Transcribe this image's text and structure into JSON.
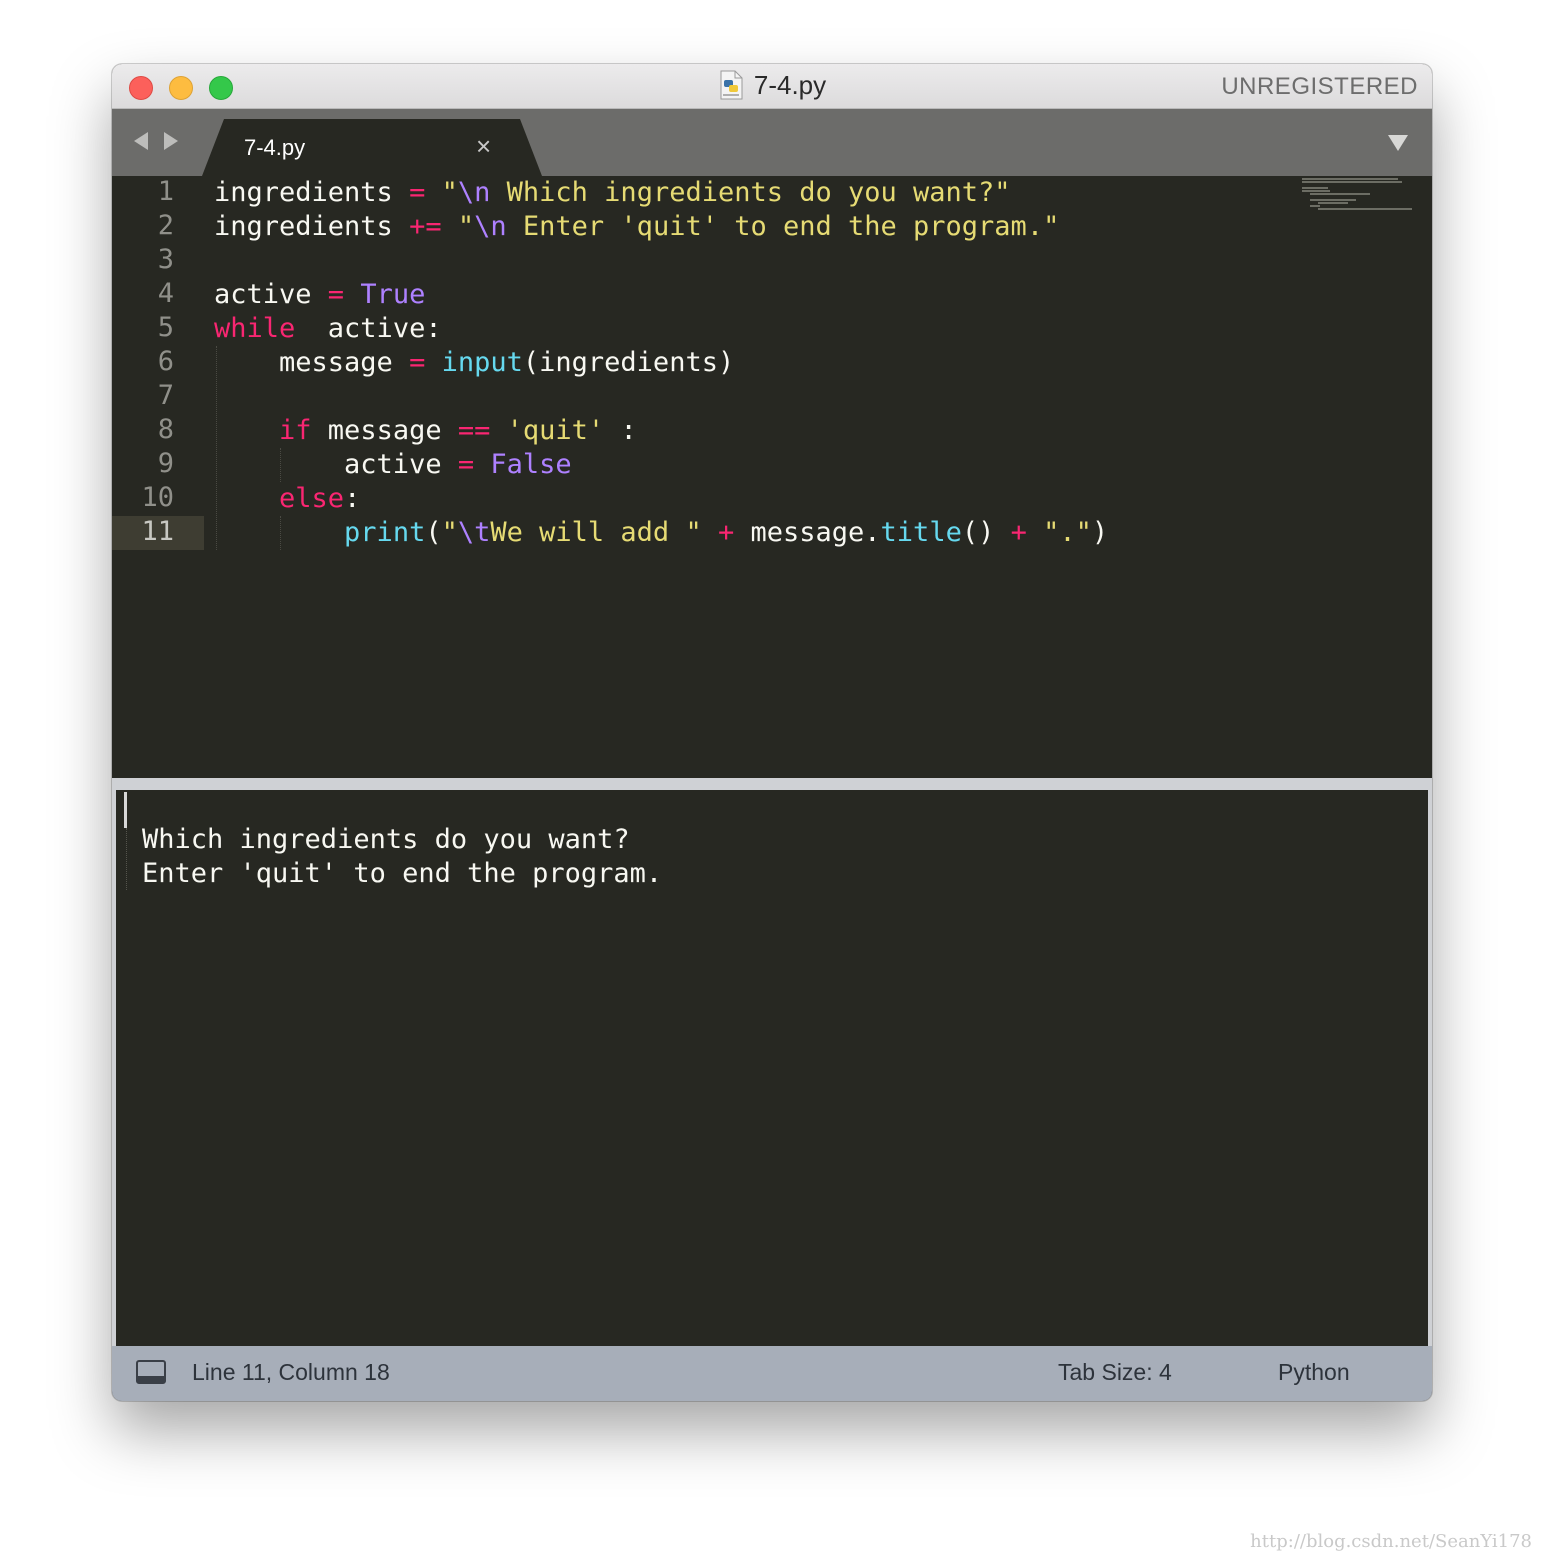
{
  "window": {
    "title": "7-4.py",
    "registration_label": "UNREGISTERED"
  },
  "tabs": [
    {
      "label": "7-4.py",
      "active": true
    }
  ],
  "editor": {
    "language": "Python",
    "current_line": 11,
    "lines": [
      {
        "number": "1",
        "text": "ingredients = \"\\n Which ingredients do you want?\""
      },
      {
        "number": "2",
        "text": "ingredients += \"\\n Enter 'quit' to end the program.\""
      },
      {
        "number": "3",
        "text": ""
      },
      {
        "number": "4",
        "text": "active = True"
      },
      {
        "number": "5",
        "text": "while  active:"
      },
      {
        "number": "6",
        "text": "    message = input(ingredients)"
      },
      {
        "number": "7",
        "text": ""
      },
      {
        "number": "8",
        "text": "    if message == 'quit' :"
      },
      {
        "number": "9",
        "text": "        active = False"
      },
      {
        "number": "10",
        "text": "    else:"
      },
      {
        "number": "11",
        "text": "        print(\"\\tWe will add \" + message.title() + \".\")"
      }
    ]
  },
  "output_panel": {
    "lines": [
      "Which ingredients do you want?",
      "Enter 'quit' to end the program."
    ]
  },
  "status_bar": {
    "position": "Line 11, Column 18",
    "tab_size": "Tab Size: 4",
    "syntax": "Python"
  },
  "watermark": "http://blog.csdn.net/SeanYi178",
  "colors": {
    "editor_background": "#272822",
    "keyword": "#f92672",
    "string": "#e6db74",
    "constant": "#ae81ff",
    "function": "#66d9ef",
    "status_bar": "#a7aeb9"
  }
}
